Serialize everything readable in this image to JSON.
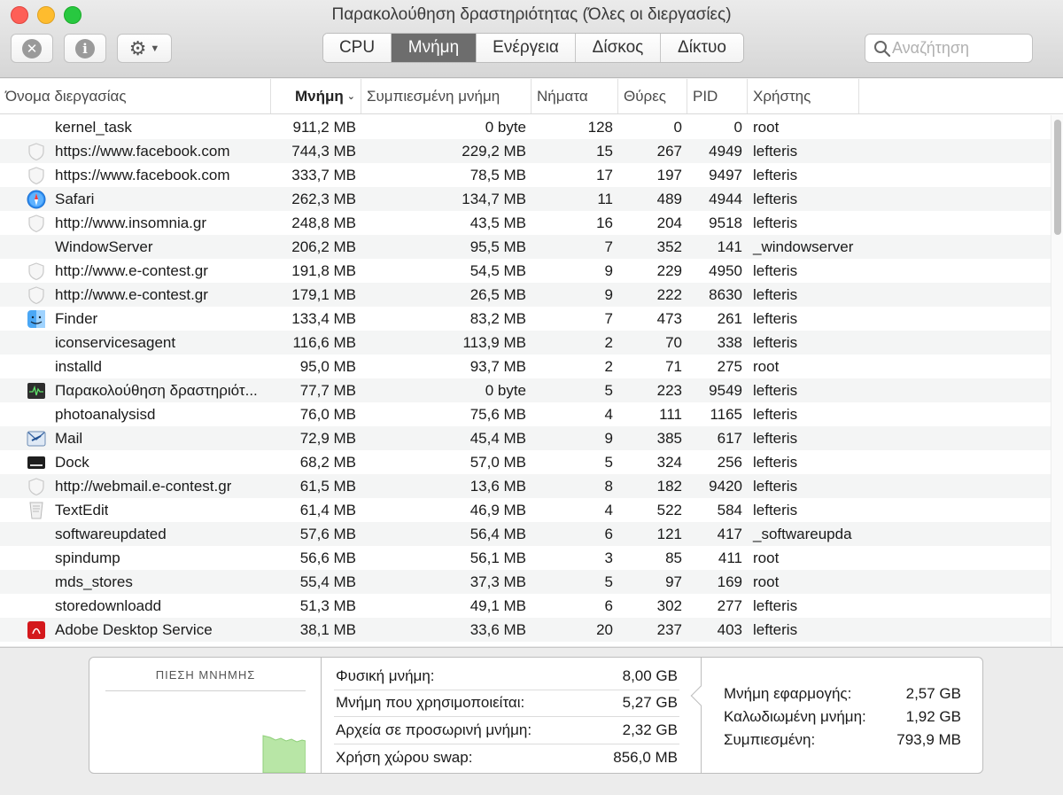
{
  "window": {
    "title": "Παρακολούθηση δραστηριότητας (Όλες οι διεργασίες)"
  },
  "toolbar": {
    "stop_icon": "x-circle-icon",
    "info_icon": "info-circle-icon",
    "gear_icon": "gear-icon",
    "tabs": [
      {
        "label": "CPU",
        "active": false
      },
      {
        "label": "Μνήμη",
        "active": true
      },
      {
        "label": "Ενέργεια",
        "active": false
      },
      {
        "label": "Δίσκος",
        "active": false
      },
      {
        "label": "Δίκτυο",
        "active": false
      }
    ],
    "search_placeholder": "Αναζήτηση"
  },
  "table": {
    "columns": {
      "name": "Όνομα διεργασίας",
      "memory": "Μνήμη",
      "compressed": "Συμπιεσμένη μνήμη",
      "threads": "Νήματα",
      "ports": "Θύρες",
      "pid": "PID",
      "user": "Χρήστης"
    },
    "rows": [
      {
        "name": "kernel_task",
        "icon": "none",
        "memory": "911,2 MB",
        "compressed": "0 byte",
        "threads": "128",
        "ports": "0",
        "pid": "0",
        "user": "root"
      },
      {
        "name": "https://www.facebook.com",
        "icon": "shield",
        "memory": "744,3 MB",
        "compressed": "229,2 MB",
        "threads": "15",
        "ports": "267",
        "pid": "4949",
        "user": "lefteris"
      },
      {
        "name": "https://www.facebook.com",
        "icon": "shield",
        "memory": "333,7 MB",
        "compressed": "78,5 MB",
        "threads": "17",
        "ports": "197",
        "pid": "9497",
        "user": "lefteris"
      },
      {
        "name": "Safari",
        "icon": "safari",
        "memory": "262,3 MB",
        "compressed": "134,7 MB",
        "threads": "11",
        "ports": "489",
        "pid": "4944",
        "user": "lefteris"
      },
      {
        "name": "http://www.insomnia.gr",
        "icon": "shield",
        "memory": "248,8 MB",
        "compressed": "43,5 MB",
        "threads": "16",
        "ports": "204",
        "pid": "9518",
        "user": "lefteris"
      },
      {
        "name": "WindowServer",
        "icon": "none",
        "memory": "206,2 MB",
        "compressed": "95,5 MB",
        "threads": "7",
        "ports": "352",
        "pid": "141",
        "user": "_windowserver"
      },
      {
        "name": "http://www.e-contest.gr",
        "icon": "shield",
        "memory": "191,8 MB",
        "compressed": "54,5 MB",
        "threads": "9",
        "ports": "229",
        "pid": "4950",
        "user": "lefteris"
      },
      {
        "name": "http://www.e-contest.gr",
        "icon": "shield",
        "memory": "179,1 MB",
        "compressed": "26,5 MB",
        "threads": "9",
        "ports": "222",
        "pid": "8630",
        "user": "lefteris"
      },
      {
        "name": "Finder",
        "icon": "finder",
        "memory": "133,4 MB",
        "compressed": "83,2 MB",
        "threads": "7",
        "ports": "473",
        "pid": "261",
        "user": "lefteris"
      },
      {
        "name": "iconservicesagent",
        "icon": "none",
        "memory": "116,6 MB",
        "compressed": "113,9 MB",
        "threads": "2",
        "ports": "70",
        "pid": "338",
        "user": "lefteris"
      },
      {
        "name": "installd",
        "icon": "none",
        "memory": "95,0 MB",
        "compressed": "93,7 MB",
        "threads": "2",
        "ports": "71",
        "pid": "275",
        "user": "root"
      },
      {
        "name": "Παρακολούθηση δραστηριότ...",
        "icon": "activity",
        "memory": "77,7 MB",
        "compressed": "0 byte",
        "threads": "5",
        "ports": "223",
        "pid": "9549",
        "user": "lefteris"
      },
      {
        "name": "photoanalysisd",
        "icon": "none",
        "memory": "76,0 MB",
        "compressed": "75,6 MB",
        "threads": "4",
        "ports": "111",
        "pid": "1165",
        "user": "lefteris"
      },
      {
        "name": "Mail",
        "icon": "mail",
        "memory": "72,9 MB",
        "compressed": "45,4 MB",
        "threads": "9",
        "ports": "385",
        "pid": "617",
        "user": "lefteris"
      },
      {
        "name": "Dock",
        "icon": "dock",
        "memory": "68,2 MB",
        "compressed": "57,0 MB",
        "threads": "5",
        "ports": "324",
        "pid": "256",
        "user": "lefteris"
      },
      {
        "name": "http://webmail.e-contest.gr",
        "icon": "shield",
        "memory": "61,5 MB",
        "compressed": "13,6 MB",
        "threads": "8",
        "ports": "182",
        "pid": "9420",
        "user": "lefteris"
      },
      {
        "name": "TextEdit",
        "icon": "textedit",
        "memory": "61,4 MB",
        "compressed": "46,9 MB",
        "threads": "4",
        "ports": "522",
        "pid": "584",
        "user": "lefteris"
      },
      {
        "name": "softwareupdated",
        "icon": "none",
        "memory": "57,6 MB",
        "compressed": "56,4 MB",
        "threads": "6",
        "ports": "121",
        "pid": "417",
        "user": "_softwareupda"
      },
      {
        "name": "spindump",
        "icon": "none",
        "memory": "56,6 MB",
        "compressed": "56,1 MB",
        "threads": "3",
        "ports": "85",
        "pid": "411",
        "user": "root"
      },
      {
        "name": "mds_stores",
        "icon": "none",
        "memory": "55,4 MB",
        "compressed": "37,3 MB",
        "threads": "5",
        "ports": "97",
        "pid": "169",
        "user": "root"
      },
      {
        "name": "storedownloadd",
        "icon": "none",
        "memory": "51,3 MB",
        "compressed": "49,1 MB",
        "threads": "6",
        "ports": "302",
        "pid": "277",
        "user": "lefteris"
      },
      {
        "name": "Adobe Desktop Service",
        "icon": "adobe",
        "memory": "38,1 MB",
        "compressed": "33,6 MB",
        "threads": "20",
        "ports": "237",
        "pid": "403",
        "user": "lefteris"
      }
    ]
  },
  "memory_panel": {
    "pressure_title": "ΠΙΕΣΗ ΜΝΗΜΗΣ",
    "pressure_color": "#b8e6a6",
    "stats": [
      {
        "label": "Φυσική μνήμη:",
        "value": "8,00 GB"
      },
      {
        "label": "Μνήμη που χρησιμοποιείται:",
        "value": "5,27 GB"
      },
      {
        "label": "Αρχεία σε προσωρινή μνήμη:",
        "value": "2,32 GB"
      },
      {
        "label": "Χρήση χώρου swap:",
        "value": "856,0 MB"
      }
    ],
    "breakdown": [
      {
        "label": "Μνήμη εφαρμογής:",
        "value": "2,57 GB"
      },
      {
        "label": "Καλωδιωμένη μνήμη:",
        "value": "1,92 GB"
      },
      {
        "label": "Συμπιεσμένη:",
        "value": "793,9 MB"
      }
    ]
  }
}
